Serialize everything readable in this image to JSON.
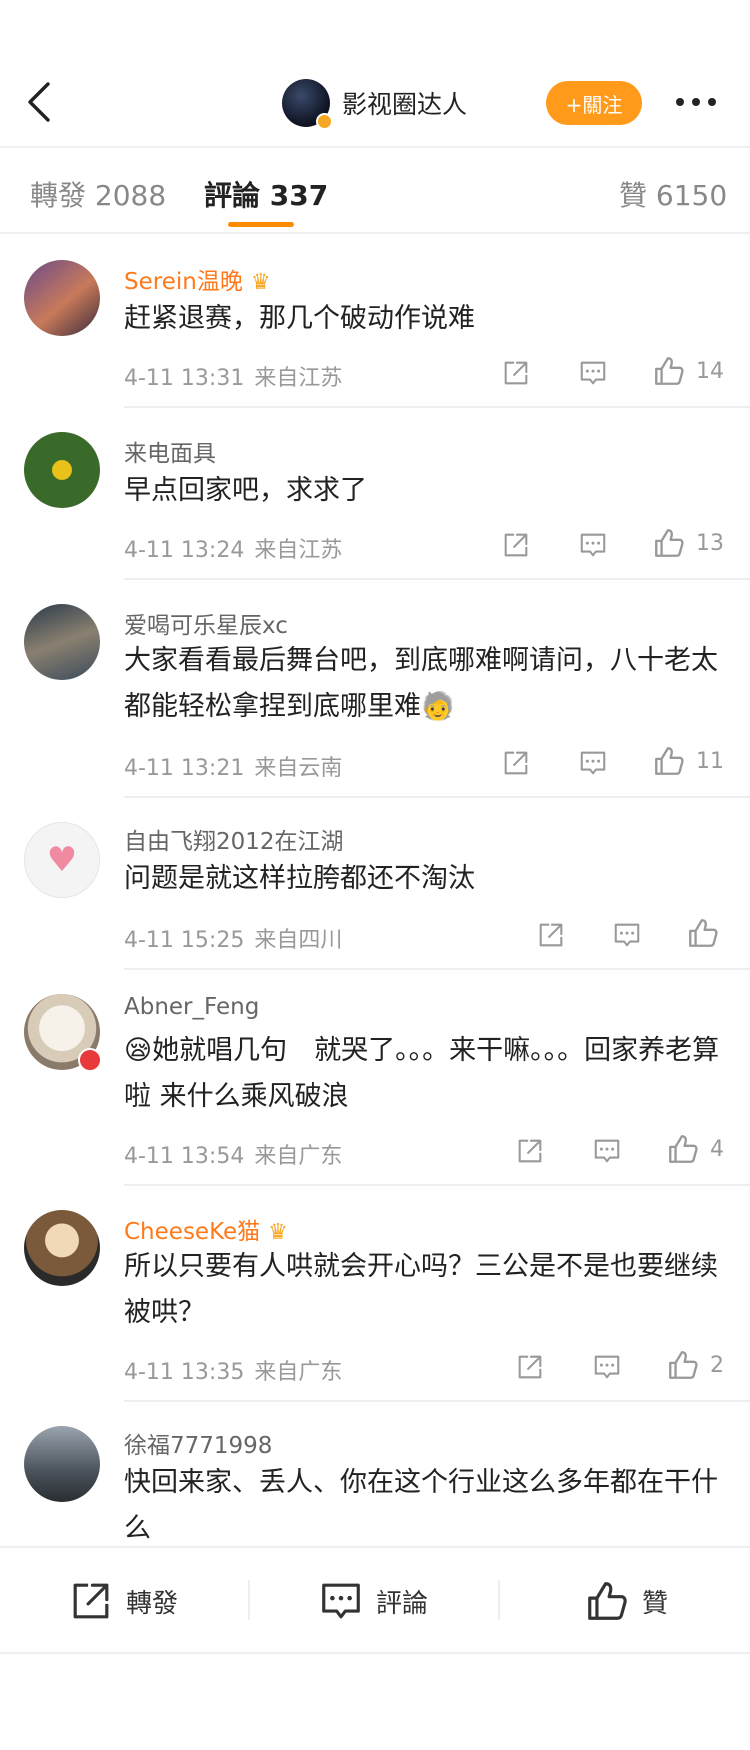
{
  "header": {
    "title": "影视圈达人",
    "follow_label": "+關注"
  },
  "tabs": {
    "repost": "轉發 2088",
    "comments": "評論 337",
    "likes": "贊 6150"
  },
  "comments": [
    {
      "user": "Serein温晚",
      "text": "赶紧退赛，那几个破动作说难",
      "time": "4-11 13:31",
      "location": "来自江苏",
      "likes": "14"
    },
    {
      "user": "来电面具",
      "text": "早点回家吧，求求了",
      "time": "4-11 13:24",
      "location": "来自江苏",
      "likes": "13"
    },
    {
      "user": "爱喝可乐星辰xc",
      "text": "大家看看最后舞台吧，到底哪难啊请问，八十老太都能轻松拿捏到底哪里难🧓",
      "time": "4-11 13:21",
      "location": "来自云南",
      "likes": "11"
    },
    {
      "user": "自由飞翔2012在江湖",
      "text": "问题是就这样拉胯都还不淘汰",
      "time": "4-11 15:25",
      "location": "来自四川",
      "likes": ""
    },
    {
      "user": "Abner_Feng",
      "text": "😪她就唱几句　就哭了。。。来干嘛。。。回家养老算啦 来什么乘风破浪",
      "time": "4-11 13:54",
      "location": "来自广东",
      "likes": "4"
    },
    {
      "user": "CheeseKe猫",
      "text": "所以只要有人哄就会开心吗？三公是不是也要继续被哄？",
      "time": "4-11 13:35",
      "location": "来自广东",
      "likes": "2"
    },
    {
      "user": "徐福7771998",
      "text": "快回来家、丢人、你在这个行业这么多年都在干什么"
    }
  ],
  "bottom_bar": {
    "repost": "轉發",
    "comment": "評論",
    "like": "贊"
  },
  "colors": {
    "accent": "#ff9a1a",
    "vip_name": "#ff7a1a",
    "muted": "#999999"
  },
  "icons": [
    "back-icon",
    "more-icon",
    "share-icon",
    "comment-icon",
    "like-icon",
    "crown-icon"
  ]
}
